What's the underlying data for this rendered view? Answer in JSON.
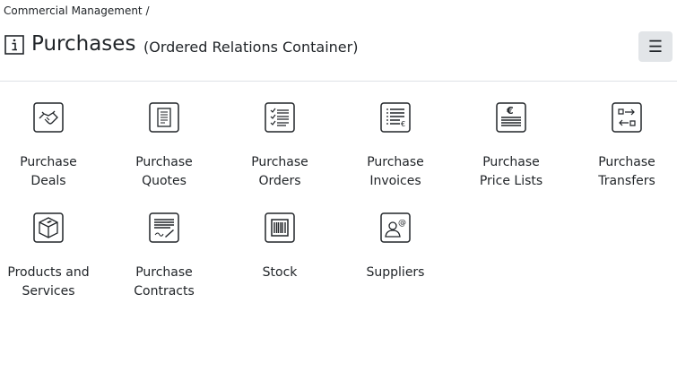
{
  "breadcrumb": "Commercial Management /",
  "header": {
    "title": "Purchases",
    "subtitle": "(Ordered Relations Container)",
    "menu_glyph": "☰"
  },
  "tiles": [
    {
      "label": "Purchase\nDeals",
      "icon": "handshake-icon"
    },
    {
      "label": "Purchase\nQuotes",
      "icon": "quote-document-icon"
    },
    {
      "label": "Purchase\nOrders",
      "icon": "order-checklist-icon"
    },
    {
      "label": "Purchase\nInvoices",
      "icon": "invoice-icon"
    },
    {
      "label": "Purchase\nPrice Lists",
      "icon": "euro-price-list-icon"
    },
    {
      "label": "Purchase\nTransfers",
      "icon": "transfer-arrows-icon"
    },
    {
      "label": "Products and\nServices",
      "icon": "box-icon"
    },
    {
      "label": "Purchase\nContracts",
      "icon": "contract-signature-icon"
    },
    {
      "label": "Stock",
      "icon": "barcode-icon"
    },
    {
      "label": "Suppliers",
      "icon": "supplier-contact-icon"
    }
  ]
}
